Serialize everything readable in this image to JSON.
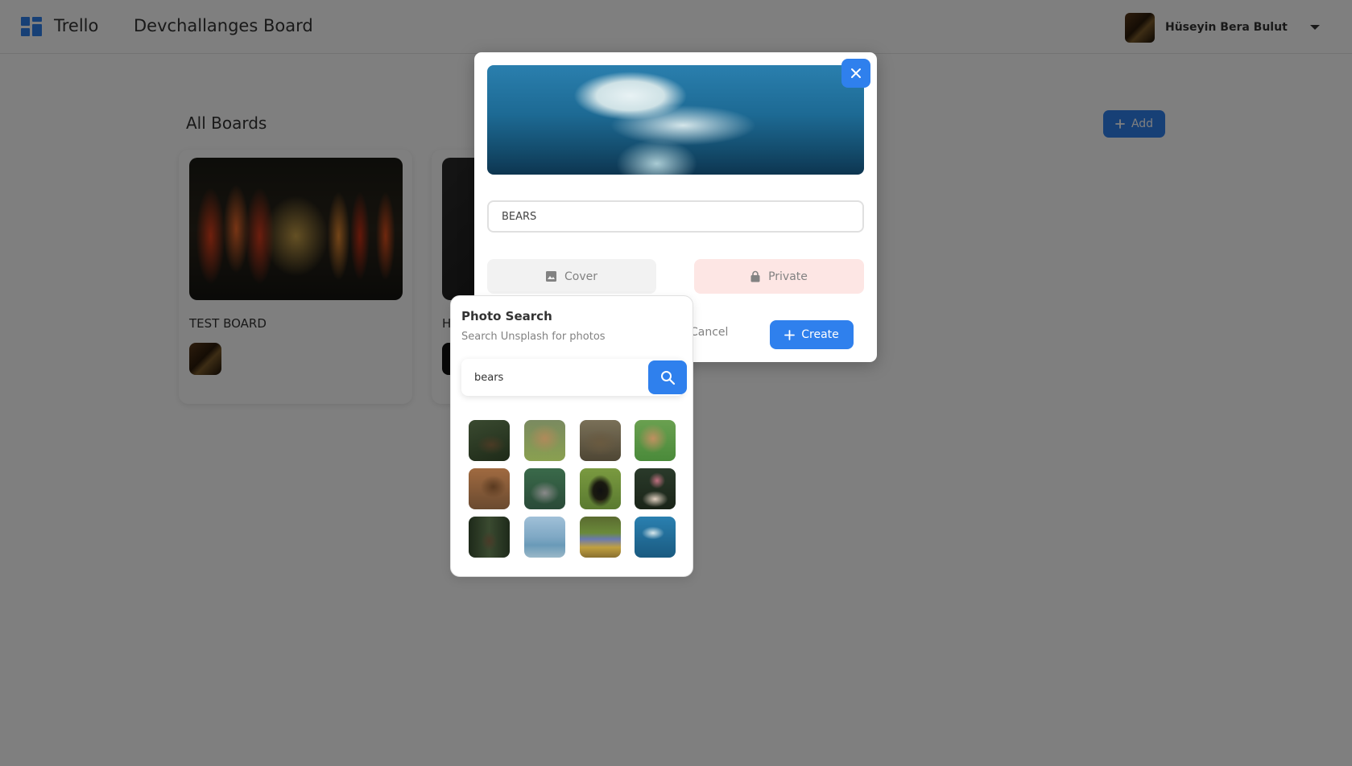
{
  "app": {
    "name": "Trello",
    "board_title": "Devchallanges Board"
  },
  "user": {
    "name": "Hüseyin Bera Bulut"
  },
  "main": {
    "section_title": "All Boards",
    "add_label": "Add",
    "boards": [
      {
        "name": "TEST BOARD"
      },
      {
        "name": "H"
      }
    ]
  },
  "modal": {
    "title_value": "BEARS",
    "cover_label": "Cover",
    "private_label": "Private",
    "cancel_label": "Cancel",
    "create_label": "Create"
  },
  "photo_search": {
    "title": "Photo Search",
    "subtitle": "Search Unsplash for photos",
    "query": "bears",
    "results_count": 12
  },
  "colors": {
    "accent": "#2f80ed",
    "private_bg": "#fde6e4",
    "cover_bg": "#f2f2f2",
    "muted_text": "#828282",
    "text": "#333333"
  },
  "icons": [
    "logo-icon",
    "chevron-down-icon",
    "plus-icon",
    "close-icon",
    "image-icon",
    "lock-icon",
    "search-icon"
  ]
}
